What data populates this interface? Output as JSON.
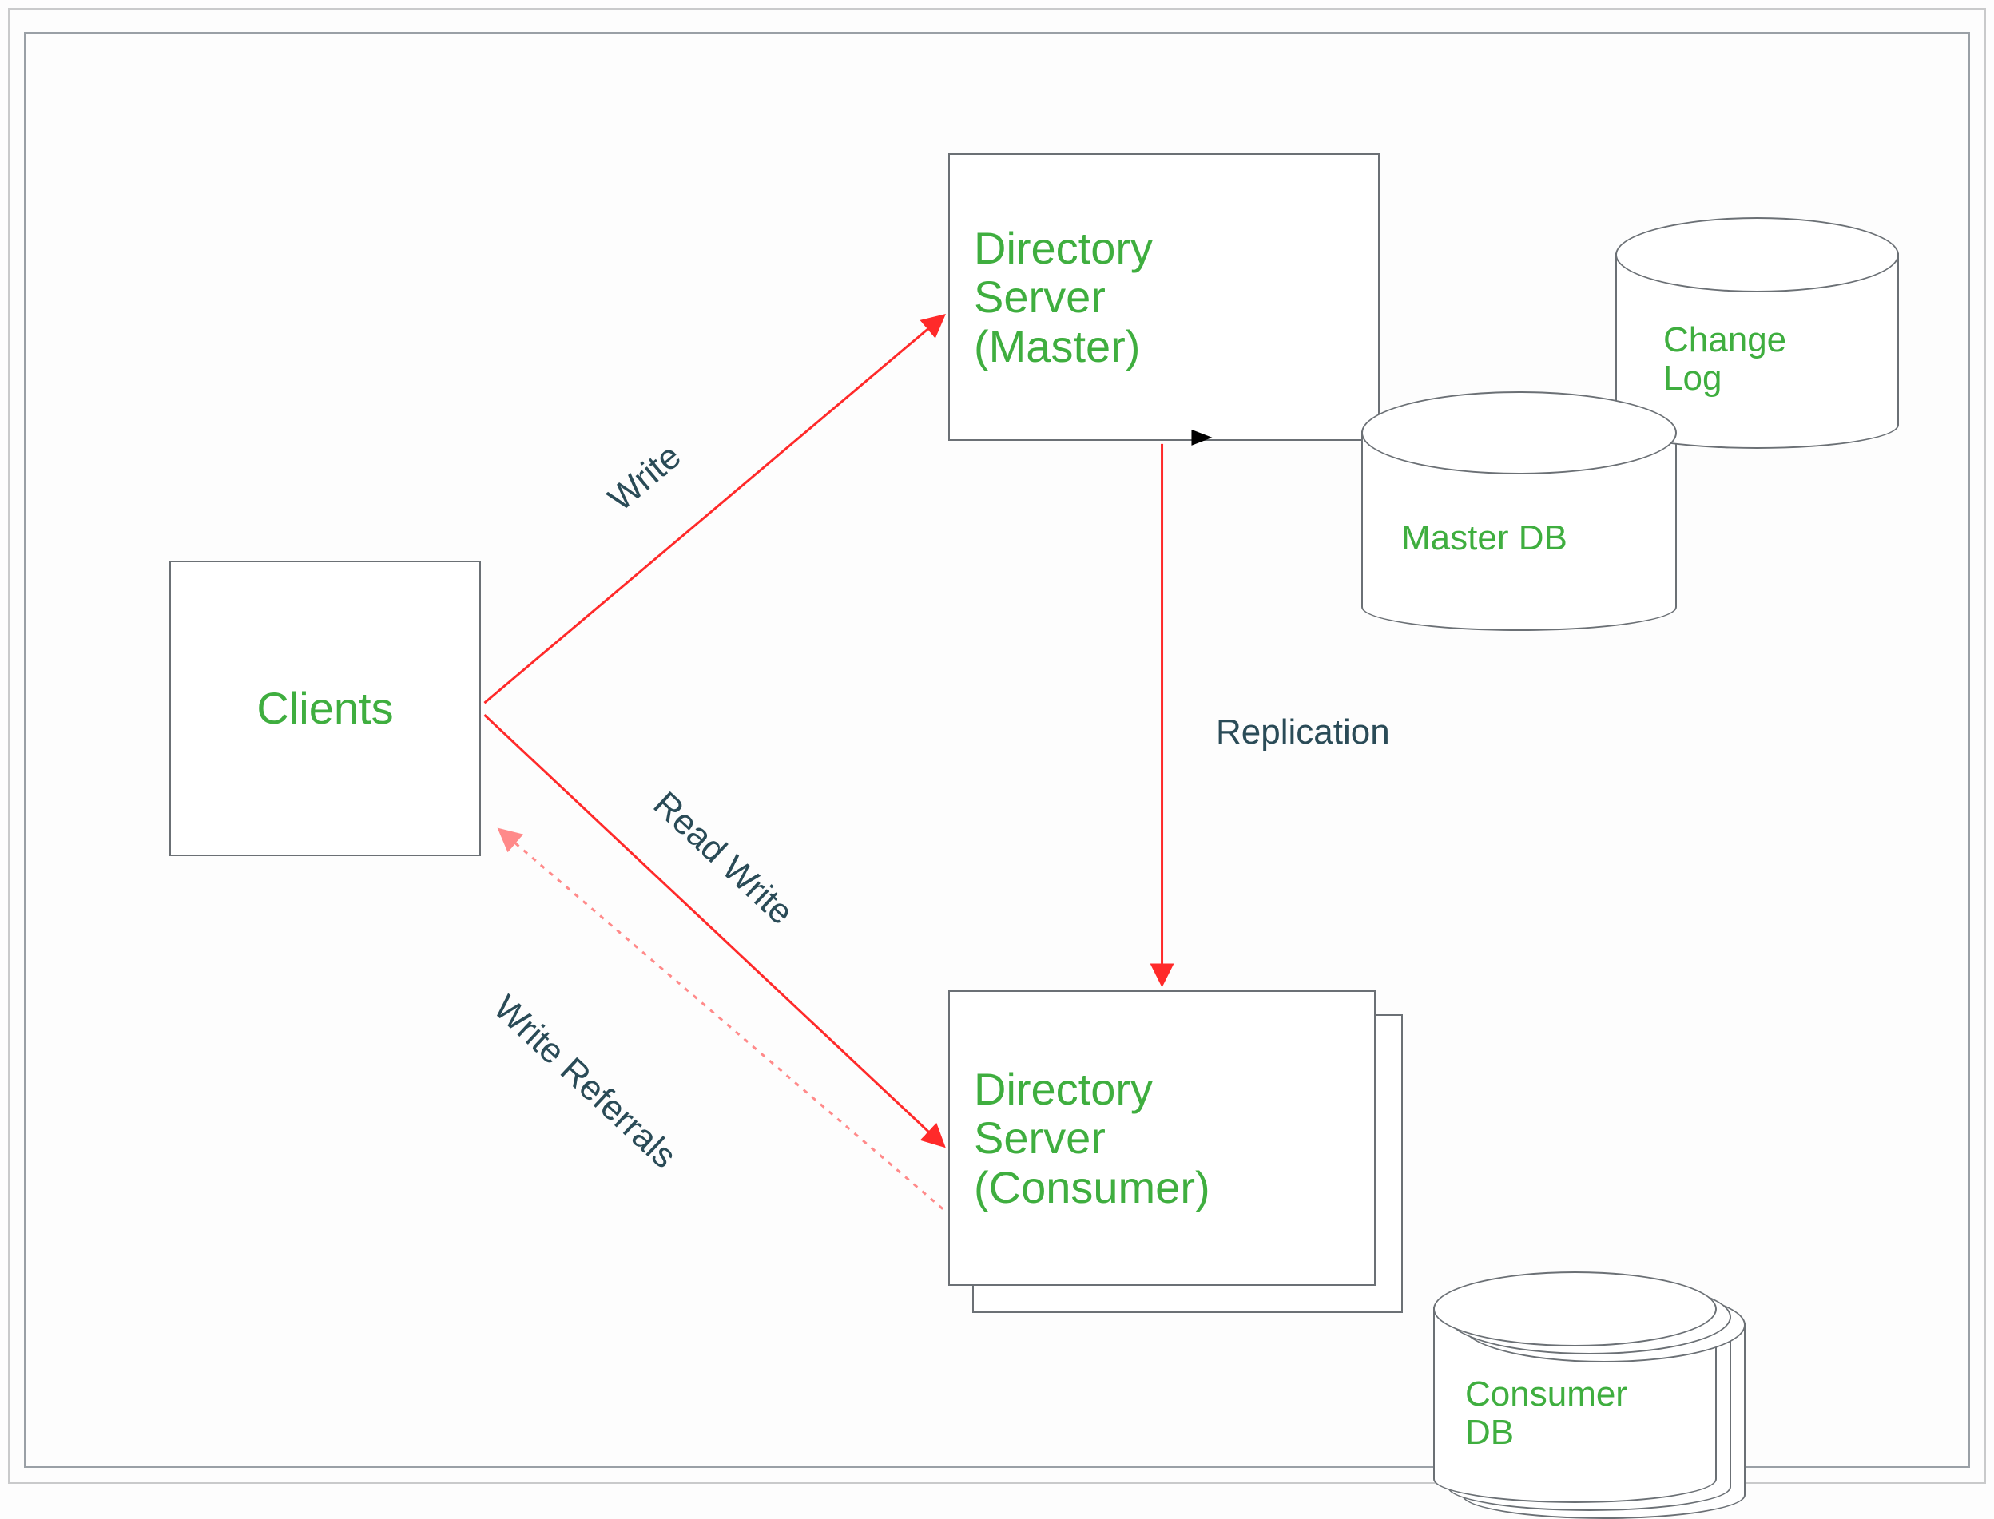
{
  "nodes": {
    "clients": "Clients",
    "master": "Directory\nServer\n(Master)",
    "consumer": "Directory\nServer\n(Consumer)",
    "masterdb": "Master DB",
    "changelog": "Change\nLog",
    "consumerdb": "Consumer\nDB"
  },
  "edges": {
    "write": "Write",
    "readwrite": "Read Write",
    "referrals": "Write Referrals",
    "replication": "Replication"
  },
  "colors": {
    "arrow": "#ff2a2a",
    "node_text": "#3fae3f",
    "edge_text": "#2a4b57",
    "border": "#6b7075"
  }
}
